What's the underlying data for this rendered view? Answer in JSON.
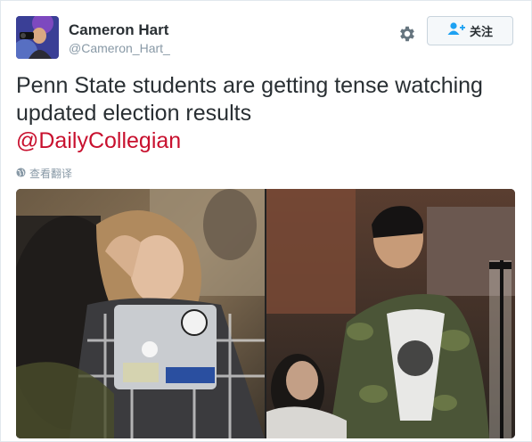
{
  "user": {
    "display_name": "Cameron Hart",
    "handle": "@Cameron_Hart_"
  },
  "header": {
    "settings_icon": "gear-icon",
    "follow_label": "关注",
    "follow_icon": "add-user-icon"
  },
  "tweet": {
    "text": "Penn State students are getting tense watching updated election results",
    "mention": "@DailyCollegian",
    "translate_label": "查看翻译",
    "translate_icon": "globe-icon"
  },
  "media": {
    "photo_count": 2
  },
  "colors": {
    "mention": "#c8102e",
    "muted": "#8899a6",
    "text": "#292f33"
  }
}
